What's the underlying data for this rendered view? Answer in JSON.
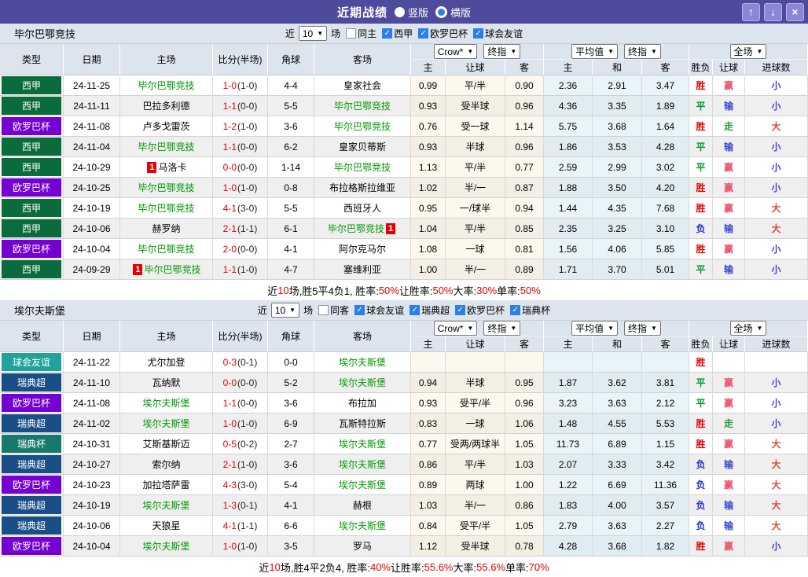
{
  "titlebar": {
    "title": "近期战绩",
    "radios": [
      {
        "label": "竖版",
        "selected": true
      },
      {
        "label": "横版",
        "selected": false
      }
    ],
    "buttons": [
      {
        "name": "up",
        "glyph": "↑"
      },
      {
        "name": "down",
        "glyph": "↓"
      },
      {
        "name": "close",
        "glyph": "×"
      }
    ]
  },
  "icons": {
    "caret": "▼",
    "check": "✓"
  },
  "colors": {
    "titlebar_bg": "#4e4a9c",
    "header_bg": "#dde4ed",
    "team_link_green": "#009900",
    "score_red": "#e60000",
    "summary_red": "#e60000"
  },
  "league_colors": {
    "西甲": "#0a6b3c",
    "欧罗巴杯": "#7400d1",
    "球会友谊": "#1fa39c",
    "瑞典超": "#1a4e86",
    "瑞典杯": "#17786d"
  },
  "result_colors": {
    "胜": "#e60000",
    "平": "#009933",
    "负": "#2233cc",
    "赢": "#f0556e",
    "输": "#3a4ad4",
    "走": "#2a9b44",
    "大": "#dd4a42",
    "小": "#4646d9"
  },
  "sections": [
    {
      "team": "毕尔巴鄂竞技",
      "filter": {
        "near_label": "近",
        "count": "10",
        "games_label": "场",
        "same": {
          "label": "同主",
          "checked": false
        },
        "leagues": [
          {
            "label": "西甲",
            "checked": true
          },
          {
            "label": "欧罗巴杯",
            "checked": true
          },
          {
            "label": "球会友谊",
            "checked": true
          }
        ]
      },
      "header": {
        "cols": [
          "类型",
          "日期",
          "主场",
          "比分(半场)",
          "角球",
          "客场"
        ],
        "selects": [
          [
            "Crow*",
            "终指"
          ],
          [
            "平均值",
            "终指"
          ],
          [
            "全场"
          ]
        ],
        "sub": [
          "主",
          "让球",
          "客",
          "主",
          "和",
          "客",
          "胜负",
          "让球",
          "进球数"
        ]
      },
      "rows": [
        {
          "league": "西甲",
          "date": "24-11-25",
          "home": "毕尔巴鄂竞技",
          "homeTeam": true,
          "homeBadge": "",
          "score": "1-0",
          "half": "(1-0)",
          "corners": "4-4",
          "away": "皇家社会",
          "awayTeam": false,
          "awayBadge": "",
          "odds": [
            "0.99",
            "平/半",
            "0.90"
          ],
          "avg": [
            "2.36",
            "2.91",
            "3.47"
          ],
          "res": [
            "胜",
            "赢",
            "小"
          ]
        },
        {
          "league": "西甲",
          "date": "24-11-11",
          "home": "巴拉多利德",
          "homeTeam": false,
          "homeBadge": "",
          "score": "1-1",
          "half": "(0-0)",
          "corners": "5-5",
          "away": "毕尔巴鄂竞技",
          "awayTeam": true,
          "awayBadge": "",
          "odds": [
            "0.93",
            "受半球",
            "0.96"
          ],
          "avg": [
            "4.36",
            "3.35",
            "1.89"
          ],
          "res": [
            "平",
            "输",
            "小"
          ]
        },
        {
          "league": "欧罗巴杯",
          "date": "24-11-08",
          "home": "卢多戈雷茨",
          "homeTeam": false,
          "homeBadge": "",
          "score": "1-2",
          "half": "(1-0)",
          "corners": "3-6",
          "away": "毕尔巴鄂竞技",
          "awayTeam": true,
          "awayBadge": "",
          "odds": [
            "0.76",
            "受一球",
            "1.14"
          ],
          "avg": [
            "5.75",
            "3.68",
            "1.64"
          ],
          "res": [
            "胜",
            "走",
            "大"
          ]
        },
        {
          "league": "西甲",
          "date": "24-11-04",
          "home": "毕尔巴鄂竞技",
          "homeTeam": true,
          "homeBadge": "",
          "score": "1-1",
          "half": "(0-0)",
          "corners": "6-2",
          "away": "皇家贝蒂斯",
          "awayTeam": false,
          "awayBadge": "",
          "odds": [
            "0.93",
            "半球",
            "0.96"
          ],
          "avg": [
            "1.86",
            "3.53",
            "4.28"
          ],
          "res": [
            "平",
            "输",
            "小"
          ]
        },
        {
          "league": "西甲",
          "date": "24-10-29",
          "home": "马洛卡",
          "homeTeam": false,
          "homeBadge": "1",
          "score": "0-0",
          "half": "(0-0)",
          "corners": "1-14",
          "away": "毕尔巴鄂竞技",
          "awayTeam": true,
          "awayBadge": "",
          "odds": [
            "1.13",
            "平/半",
            "0.77"
          ],
          "avg": [
            "2.59",
            "2.99",
            "3.02"
          ],
          "res": [
            "平",
            "赢",
            "小"
          ]
        },
        {
          "league": "欧罗巴杯",
          "date": "24-10-25",
          "home": "毕尔巴鄂竞技",
          "homeTeam": true,
          "homeBadge": "",
          "score": "1-0",
          "half": "(1-0)",
          "corners": "0-8",
          "away": "布拉格斯拉维亚",
          "awayTeam": false,
          "awayBadge": "",
          "odds": [
            "1.02",
            "半/一",
            "0.87"
          ],
          "avg": [
            "1.88",
            "3.50",
            "4.20"
          ],
          "res": [
            "胜",
            "赢",
            "小"
          ]
        },
        {
          "league": "西甲",
          "date": "24-10-19",
          "home": "毕尔巴鄂竞技",
          "homeTeam": true,
          "homeBadge": "",
          "score": "4-1",
          "half": "(3-0)",
          "corners": "5-5",
          "away": "西班牙人",
          "awayTeam": false,
          "awayBadge": "",
          "odds": [
            "0.95",
            "一/球半",
            "0.94"
          ],
          "avg": [
            "1.44",
            "4.35",
            "7.68"
          ],
          "res": [
            "胜",
            "赢",
            "大"
          ]
        },
        {
          "league": "西甲",
          "date": "24-10-06",
          "home": "赫罗纳",
          "homeTeam": false,
          "homeBadge": "",
          "score": "2-1",
          "half": "(1-1)",
          "corners": "6-1",
          "away": "毕尔巴鄂竞技",
          "awayTeam": true,
          "awayBadge": "1",
          "odds": [
            "1.04",
            "平/半",
            "0.85"
          ],
          "avg": [
            "2.35",
            "3.25",
            "3.10"
          ],
          "res": [
            "负",
            "输",
            "大"
          ]
        },
        {
          "league": "欧罗巴杯",
          "date": "24-10-04",
          "home": "毕尔巴鄂竞技",
          "homeTeam": true,
          "homeBadge": "",
          "score": "2-0",
          "half": "(0-0)",
          "corners": "4-1",
          "away": "阿尔克马尔",
          "awayTeam": false,
          "awayBadge": "",
          "odds": [
            "1.08",
            "一球",
            "0.81"
          ],
          "avg": [
            "1.56",
            "4.06",
            "5.85"
          ],
          "res": [
            "胜",
            "赢",
            "小"
          ]
        },
        {
          "league": "西甲",
          "date": "24-09-29",
          "home": "毕尔巴鄂竞技",
          "homeTeam": true,
          "homeBadge": "1",
          "score": "1-1",
          "half": "(1-0)",
          "corners": "4-7",
          "away": "塞维利亚",
          "awayTeam": false,
          "awayBadge": "",
          "odds": [
            "1.00",
            "半/一",
            "0.89"
          ],
          "avg": [
            "1.71",
            "3.70",
            "5.01"
          ],
          "res": [
            "平",
            "输",
            "小"
          ]
        }
      ],
      "summary": [
        {
          "t": "近",
          "red": false
        },
        {
          "t": "10",
          "red": true
        },
        {
          "t": "场,胜5平4负1, 胜率:",
          "red": false
        },
        {
          "t": "50%",
          "red": true
        },
        {
          "t": " 让胜率:",
          "red": false
        },
        {
          "t": "50%",
          "red": true
        },
        {
          "t": " 大率:",
          "red": false
        },
        {
          "t": "30%",
          "red": true
        },
        {
          "t": " 单率:",
          "red": false
        },
        {
          "t": "50%",
          "red": true
        }
      ]
    },
    {
      "team": "埃尔夫斯堡",
      "filter": {
        "near_label": "近",
        "count": "10",
        "games_label": "场",
        "same": {
          "label": "同客",
          "checked": false
        },
        "leagues": [
          {
            "label": "球会友谊",
            "checked": true
          },
          {
            "label": "瑞典超",
            "checked": true
          },
          {
            "label": "欧罗巴杯",
            "checked": true
          },
          {
            "label": "瑞典杯",
            "checked": true
          }
        ]
      },
      "header": {
        "cols": [
          "类型",
          "日期",
          "主场",
          "比分(半场)",
          "角球",
          "客场"
        ],
        "selects": [
          [
            "Crow*",
            "终指"
          ],
          [
            "平均值",
            "终指"
          ],
          [
            "全场"
          ]
        ],
        "sub": [
          "主",
          "让球",
          "客",
          "主",
          "和",
          "客",
          "胜负",
          "让球",
          "进球数"
        ]
      },
      "rows": [
        {
          "league": "球会友谊",
          "date": "24-11-22",
          "home": "尤尔加登",
          "homeTeam": false,
          "homeBadge": "",
          "score": "0-3",
          "half": "(0-1)",
          "corners": "0-0",
          "away": "埃尔夫斯堡",
          "awayTeam": true,
          "awayBadge": "",
          "odds": [
            "",
            "",
            ""
          ],
          "avg": [
            "",
            "",
            ""
          ],
          "res": [
            "胜",
            "",
            ""
          ]
        },
        {
          "league": "瑞典超",
          "date": "24-11-10",
          "home": "瓦纳默",
          "homeTeam": false,
          "homeBadge": "",
          "score": "0-0",
          "half": "(0-0)",
          "corners": "5-2",
          "away": "埃尔夫斯堡",
          "awayTeam": true,
          "awayBadge": "",
          "odds": [
            "0.94",
            "半球",
            "0.95"
          ],
          "avg": [
            "1.87",
            "3.62",
            "3.81"
          ],
          "res": [
            "平",
            "赢",
            "小"
          ]
        },
        {
          "league": "欧罗巴杯",
          "date": "24-11-08",
          "home": "埃尔夫斯堡",
          "homeTeam": true,
          "homeBadge": "",
          "score": "1-1",
          "half": "(0-0)",
          "corners": "3-6",
          "away": "布拉加",
          "awayTeam": false,
          "awayBadge": "",
          "odds": [
            "0.93",
            "受平/半",
            "0.96"
          ],
          "avg": [
            "3.23",
            "3.63",
            "2.12"
          ],
          "res": [
            "平",
            "赢",
            "小"
          ]
        },
        {
          "league": "瑞典超",
          "date": "24-11-02",
          "home": "埃尔夫斯堡",
          "homeTeam": true,
          "homeBadge": "",
          "score": "1-0",
          "half": "(1-0)",
          "corners": "6-9",
          "away": "瓦斯特拉斯",
          "awayTeam": false,
          "awayBadge": "",
          "odds": [
            "0.83",
            "一球",
            "1.06"
          ],
          "avg": [
            "1.48",
            "4.55",
            "5.53"
          ],
          "res": [
            "胜",
            "走",
            "小"
          ]
        },
        {
          "league": "瑞典杯",
          "date": "24-10-31",
          "home": "艾斯基斯迈",
          "homeTeam": false,
          "homeBadge": "",
          "score": "0-5",
          "half": "(0-2)",
          "corners": "2-7",
          "away": "埃尔夫斯堡",
          "awayTeam": true,
          "awayBadge": "",
          "odds": [
            "0.77",
            "受两/两球半",
            "1.05"
          ],
          "avg": [
            "11.73",
            "6.89",
            "1.15"
          ],
          "res": [
            "胜",
            "赢",
            "大"
          ]
        },
        {
          "league": "瑞典超",
          "date": "24-10-27",
          "home": "索尔纳",
          "homeTeam": false,
          "homeBadge": "",
          "score": "2-1",
          "half": "(1-0)",
          "corners": "3-6",
          "away": "埃尔夫斯堡",
          "awayTeam": true,
          "awayBadge": "",
          "odds": [
            "0.86",
            "平/半",
            "1.03"
          ],
          "avg": [
            "2.07",
            "3.33",
            "3.42"
          ],
          "res": [
            "负",
            "输",
            "大"
          ]
        },
        {
          "league": "欧罗巴杯",
          "date": "24-10-23",
          "home": "加拉塔萨雷",
          "homeTeam": false,
          "homeBadge": "",
          "score": "4-3",
          "half": "(3-0)",
          "corners": "5-4",
          "away": "埃尔夫斯堡",
          "awayTeam": true,
          "awayBadge": "",
          "odds": [
            "0.89",
            "两球",
            "1.00"
          ],
          "avg": [
            "1.22",
            "6.69",
            "11.36"
          ],
          "res": [
            "负",
            "赢",
            "大"
          ]
        },
        {
          "league": "瑞典超",
          "date": "24-10-19",
          "home": "埃尔夫斯堡",
          "homeTeam": true,
          "homeBadge": "",
          "score": "1-3",
          "half": "(0-1)",
          "corners": "4-1",
          "away": "赫根",
          "awayTeam": false,
          "awayBadge": "",
          "odds": [
            "1.03",
            "半/一",
            "0.86"
          ],
          "avg": [
            "1.83",
            "4.00",
            "3.57"
          ],
          "res": [
            "负",
            "输",
            "大"
          ]
        },
        {
          "league": "瑞典超",
          "date": "24-10-06",
          "home": "天狼星",
          "homeTeam": false,
          "homeBadge": "",
          "score": "4-1",
          "half": "(1-1)",
          "corners": "6-6",
          "away": "埃尔夫斯堡",
          "awayTeam": true,
          "awayBadge": "",
          "odds": [
            "0.84",
            "受平/半",
            "1.05"
          ],
          "avg": [
            "2.79",
            "3.63",
            "2.27"
          ],
          "res": [
            "负",
            "输",
            "大"
          ]
        },
        {
          "league": "欧罗巴杯",
          "date": "24-10-04",
          "home": "埃尔夫斯堡",
          "homeTeam": true,
          "homeBadge": "",
          "score": "1-0",
          "half": "(1-0)",
          "corners": "3-5",
          "away": "罗马",
          "awayTeam": false,
          "awayBadge": "",
          "odds": [
            "1.12",
            "受半球",
            "0.78"
          ],
          "avg": [
            "4.28",
            "3.68",
            "1.82"
          ],
          "res": [
            "胜",
            "赢",
            "小"
          ]
        }
      ],
      "summary": [
        {
          "t": "近",
          "red": false
        },
        {
          "t": "10",
          "red": true
        },
        {
          "t": "场,胜4平2负4, 胜率:",
          "red": false
        },
        {
          "t": "40%",
          "red": true
        },
        {
          "t": " 让胜率:",
          "red": false
        },
        {
          "t": "55.6%",
          "red": true
        },
        {
          "t": " 大率:",
          "red": false
        },
        {
          "t": "55.6%",
          "red": true
        },
        {
          "t": " 单率:",
          "red": false
        },
        {
          "t": "70%",
          "red": true
        }
      ]
    }
  ]
}
